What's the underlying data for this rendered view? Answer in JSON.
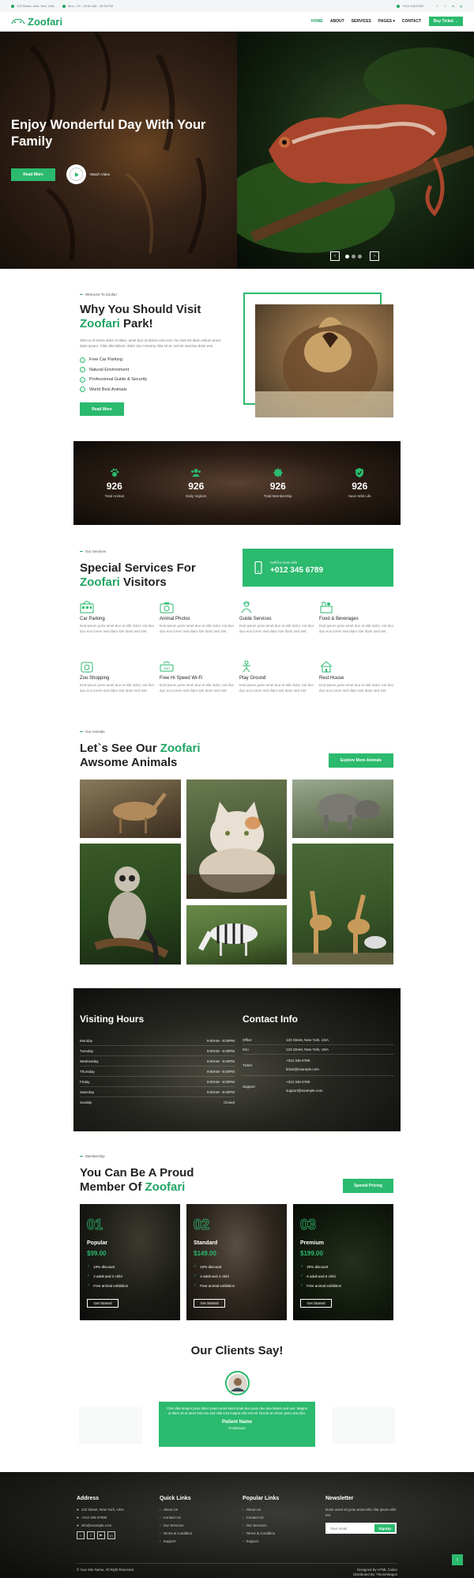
{
  "topbar": {
    "address": "123 Street, New York, USA",
    "hours": "Mon - Fri : 09.00 AM - 09.00 PM",
    "phone": "+012 345 6789",
    "social": [
      "f",
      "t",
      "in",
      "ig"
    ]
  },
  "nav": {
    "logo": "Zoofari",
    "items": [
      "HOME",
      "ABOUT",
      "SERVICES",
      "PAGES ▾",
      "CONTACT"
    ],
    "cta": "Buy Ticket →"
  },
  "hero": {
    "title": "Enjoy Wonderful Day With Your Family",
    "read_more": "Read More",
    "watch_video": "Watch Video"
  },
  "about": {
    "tag": "Welcome To Zoofari",
    "title_a": "Why You Should Visit",
    "title_b": "Zoofari",
    "title_c": " Park!",
    "text": "Stet no et lorem dolor et diam, amet duo ut dolore vero eos. No stet est diam rebum amet diam ipsum. Clita clita labore, dolor duo nonumy clita sit at, sed sit sanctus dolor eos.",
    "features": [
      "Free Car Parking",
      "Natural Environment",
      "Professional Guide & Security",
      "World Best Animals"
    ],
    "button": "Read More"
  },
  "counters": [
    {
      "icon": "paw-icon",
      "num": "926",
      "label": "Total Animal"
    },
    {
      "icon": "users-icon",
      "num": "926",
      "label": "Daily Vigitors"
    },
    {
      "icon": "certificate-icon",
      "num": "926",
      "label": "Total Membership"
    },
    {
      "icon": "shield-icon",
      "num": "926",
      "label": "Save Wild Life"
    }
  ],
  "services": {
    "tag": "Our Services",
    "title_a": "Special Services For",
    "title_b": "Zoofari",
    "title_c": " Visitors",
    "call_label": "Call for more info",
    "call_number": "+012 345 6789",
    "items": [
      {
        "icon": "parking-icon",
        "title": "Car Parking"
      },
      {
        "icon": "photo-icon",
        "title": "Animal Photos"
      },
      {
        "icon": "guide-icon",
        "title": "Guide Services"
      },
      {
        "icon": "food-icon",
        "title": "Food & Beverages"
      },
      {
        "icon": "shop-icon",
        "title": "Zoo Shopping"
      },
      {
        "icon": "wifi-icon",
        "title": "Free Hi Speed Wi-Fi"
      },
      {
        "icon": "playground-icon",
        "title": "Play Ground"
      },
      {
        "icon": "rest-icon",
        "title": "Rest House"
      }
    ],
    "desc": "Erat ipsum justo amet duo et elitr dolor, est duo duo eos lorem sed diam stet diam sed stet."
  },
  "animals": {
    "tag": "Our Animals",
    "title_a": "Let`s See Our ",
    "title_b": "Zoofari",
    "title_c": "Awsome Animals",
    "button": "Explore More Animals"
  },
  "hours": {
    "title": "Visiting Hours",
    "rows": [
      {
        "day": "Monday",
        "time": "9:00AM - 6:00PM"
      },
      {
        "day": "Tuesday",
        "time": "9:00AM - 6:00PM"
      },
      {
        "day": "Wednesday",
        "time": "9:00AM - 6:00PM"
      },
      {
        "day": "Thursday",
        "time": "9:00AM - 6:00PM"
      },
      {
        "day": "Friday",
        "time": "9:00AM - 6:00PM"
      },
      {
        "day": "Saturday",
        "time": "9:00AM - 6:00PM"
      },
      {
        "day": "Sunday",
        "time": "Closed"
      }
    ]
  },
  "contact": {
    "title": "Contact Info",
    "rows": [
      {
        "k": "Office",
        "v": [
          "123 Street, New York, USA"
        ]
      },
      {
        "k": "Zoo",
        "v": [
          "123 Street, New York, USA"
        ]
      },
      {
        "k": "Ticket",
        "v": [
          "+012 345 6789",
          "ticket@example.com"
        ]
      },
      {
        "k": "Support",
        "v": [
          "+012 345 6789",
          "support@example.com"
        ]
      }
    ]
  },
  "membership": {
    "tag": "Membership",
    "title_a": "You Can Be A Proud",
    "title_b": "Member Of ",
    "title_c": "Zoofari",
    "button": "Special Pricing",
    "plans": [
      {
        "num": "01",
        "name": "Popular",
        "price": "$99.00",
        "features": [
          "10% discount",
          "2 adult and 2 child",
          "Free animal exhibition"
        ],
        "cta": "Get Started"
      },
      {
        "num": "02",
        "name": "Standard",
        "price": "$149.00",
        "features": [
          "15% discount",
          "4 adult and 4 child",
          "Free animal exhibition"
        ],
        "cta": "Get Started"
      },
      {
        "num": "03",
        "name": "Premium",
        "price": "$199.00",
        "features": [
          "20% discount",
          "6 adult and 6 child",
          "Free animal exhibition"
        ],
        "cta": "Get Started"
      }
    ]
  },
  "testimonial": {
    "title": "Our Clients Say!",
    "text": "Clita clita tempor justo dolor ipsum amet kasd amet duo justo duo duo labore sed sed. Magna ut diam sit et amet stet eos sed clita erat magna elitr erat sit sit erat at rebum justo sea clita.",
    "name": "Patient Name",
    "role": "Profession"
  },
  "footer": {
    "address_title": "Address",
    "address": [
      "123 Street, New York, USA",
      "+012 345 67890",
      "info@example.com"
    ],
    "quick_title": "Quick Links",
    "quick": [
      "About Us",
      "Contact Us",
      "Our Services",
      "Terms & Condition",
      "Support"
    ],
    "popular_title": "Popular Links",
    "popular": [
      "About Us",
      "Contact Us",
      "Our Services",
      "Terms & Condition",
      "Support"
    ],
    "newsletter_title": "Newsletter",
    "newsletter_text": "Dolor amet sit justo amet elitr clita ipsum elitr est.",
    "email_placeholder": "Your email",
    "signup": "SignUp",
    "copyright": "© Your Site Name, All Right Reserved.",
    "designed": "Designed By HTML Codex",
    "distributed": "Distributed By: ThemeWagon"
  },
  "colors": {
    "accent": "#2bba6e",
    "dark": "#222222"
  }
}
